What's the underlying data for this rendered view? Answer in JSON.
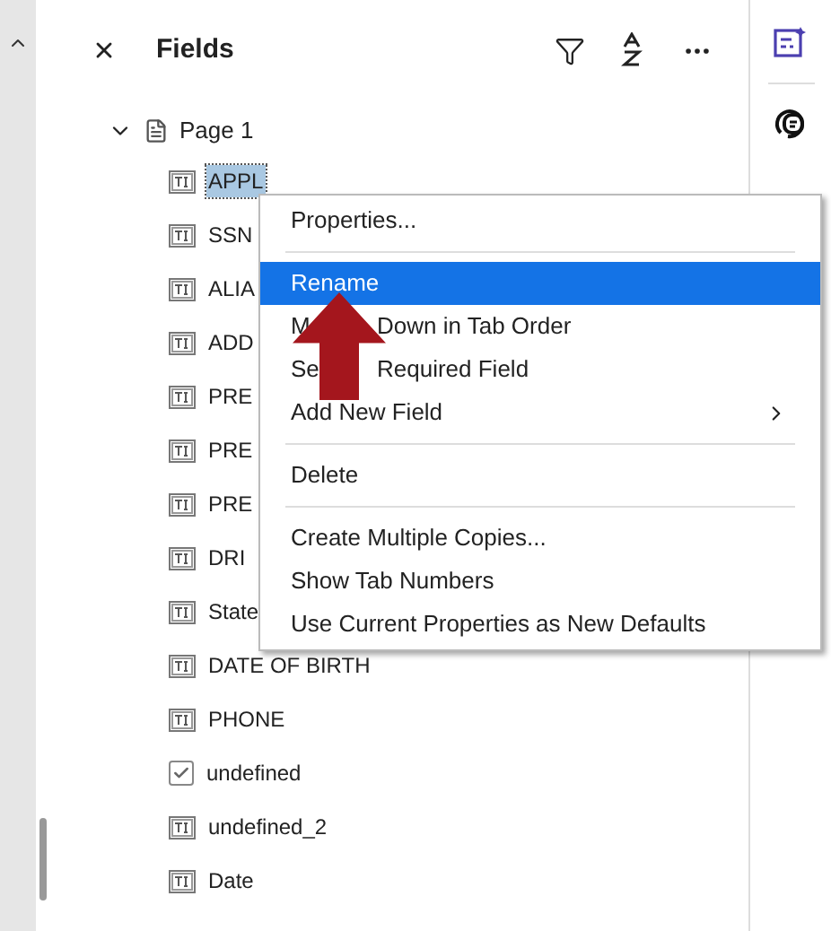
{
  "panel": {
    "title": "Fields"
  },
  "tree": [
    {
      "label": "Page 1",
      "expanded": true,
      "children": [
        {
          "label": "APPL",
          "kind": "text",
          "selected": true
        },
        {
          "label": "SSN",
          "kind": "text",
          "selected": false
        },
        {
          "label": "ALIA",
          "kind": "text",
          "selected": false
        },
        {
          "label": "ADD",
          "kind": "text",
          "selected": false
        },
        {
          "label": "PRE",
          "kind": "text",
          "selected": false
        },
        {
          "label": "PRE",
          "kind": "text",
          "selected": false
        },
        {
          "label": "PRE",
          "kind": "text",
          "selected": false
        },
        {
          "label": "DRI",
          "kind": "text",
          "selected": false
        },
        {
          "label": "State",
          "kind": "text",
          "selected": false
        },
        {
          "label": "DATE OF BIRTH",
          "kind": "text",
          "selected": false
        },
        {
          "label": "PHONE",
          "kind": "text",
          "selected": false
        },
        {
          "label": "undefined",
          "kind": "checkbox",
          "selected": false
        },
        {
          "label": "undefined_2",
          "kind": "text",
          "selected": false
        },
        {
          "label": "Date",
          "kind": "text",
          "selected": false
        }
      ]
    }
  ],
  "context_menu": [
    {
      "kind": "item",
      "label": "Properties...",
      "selected": false
    },
    {
      "kind": "separator"
    },
    {
      "kind": "item",
      "label": "Rename",
      "selected": true
    },
    {
      "kind": "item",
      "label": "M",
      "label_after_arrow": "Down in Tab Order",
      "selected": false
    },
    {
      "kind": "item",
      "label": "Se",
      "label_after_arrow": "Required Field",
      "selected": false
    },
    {
      "kind": "submenu",
      "label": "Add New Field",
      "selected": false
    },
    {
      "kind": "separator"
    },
    {
      "kind": "item",
      "label": "Delete",
      "selected": false
    },
    {
      "kind": "separator"
    },
    {
      "kind": "item",
      "label": "Create Multiple Copies...",
      "selected": false
    },
    {
      "kind": "item",
      "label": "Show Tab Numbers",
      "selected": false
    },
    {
      "kind": "item",
      "label": "Use Current Properties as New Defaults",
      "selected": false
    }
  ]
}
